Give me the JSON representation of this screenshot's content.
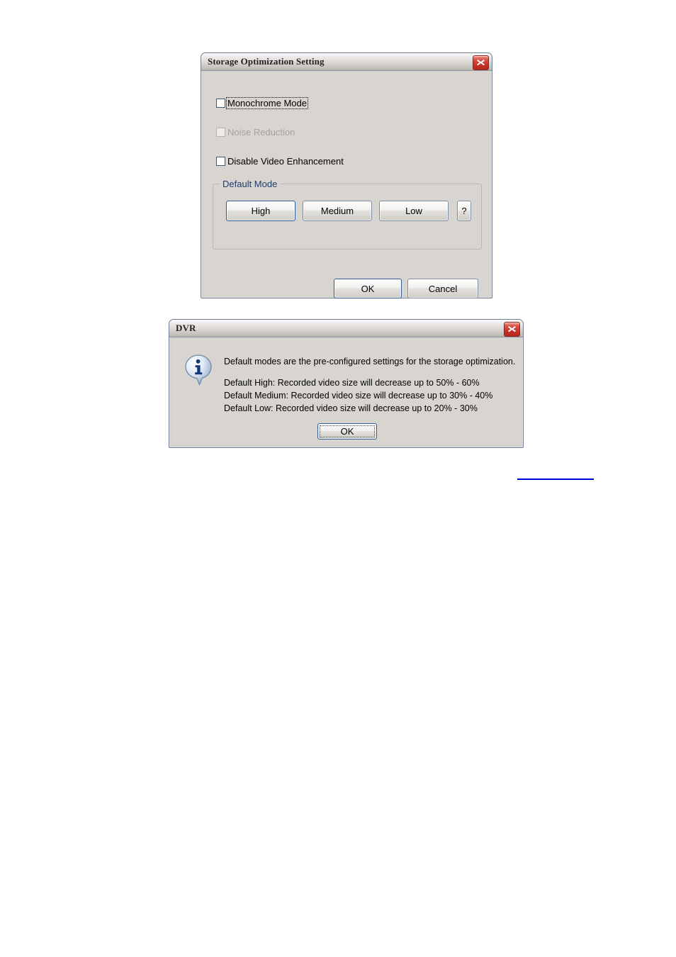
{
  "storage_dialog": {
    "title": "Storage Optimization Setting",
    "close_icon": "close-icon",
    "checkboxes": [
      {
        "label": "Monochrome Mode",
        "checked": false,
        "disabled": false,
        "focused": true
      },
      {
        "label": "Noise Reduction",
        "checked": false,
        "disabled": true,
        "focused": false
      },
      {
        "label": "Disable Video Enhancement",
        "checked": false,
        "disabled": false,
        "focused": false
      }
    ],
    "group": {
      "title": "Default Mode",
      "title_color": "#1f3c6e",
      "buttons": [
        {
          "label": "High",
          "default": true
        },
        {
          "label": "Medium",
          "default": false
        },
        {
          "label": "Low",
          "default": false
        }
      ],
      "help_button": {
        "label": "?"
      }
    },
    "footer": {
      "ok_label": "OK",
      "cancel_label": "Cancel",
      "default_button": "OK"
    }
  },
  "dvr_dialog": {
    "title": "DVR",
    "close_icon": "close-icon",
    "icon": "info-icon",
    "message_lines": [
      "Default modes are the pre-configured settings for the storage optimization.",
      "Default High: Recorded video size will decrease up to 50% - 60%",
      "Default Medium: Recorded video size will decrease up to 30% - 40%",
      "Default Low: Recorded video size will decrease up to 20% - 30%"
    ],
    "ok_label": "OK"
  },
  "page": {
    "link_rule_color": "#0000d4"
  }
}
